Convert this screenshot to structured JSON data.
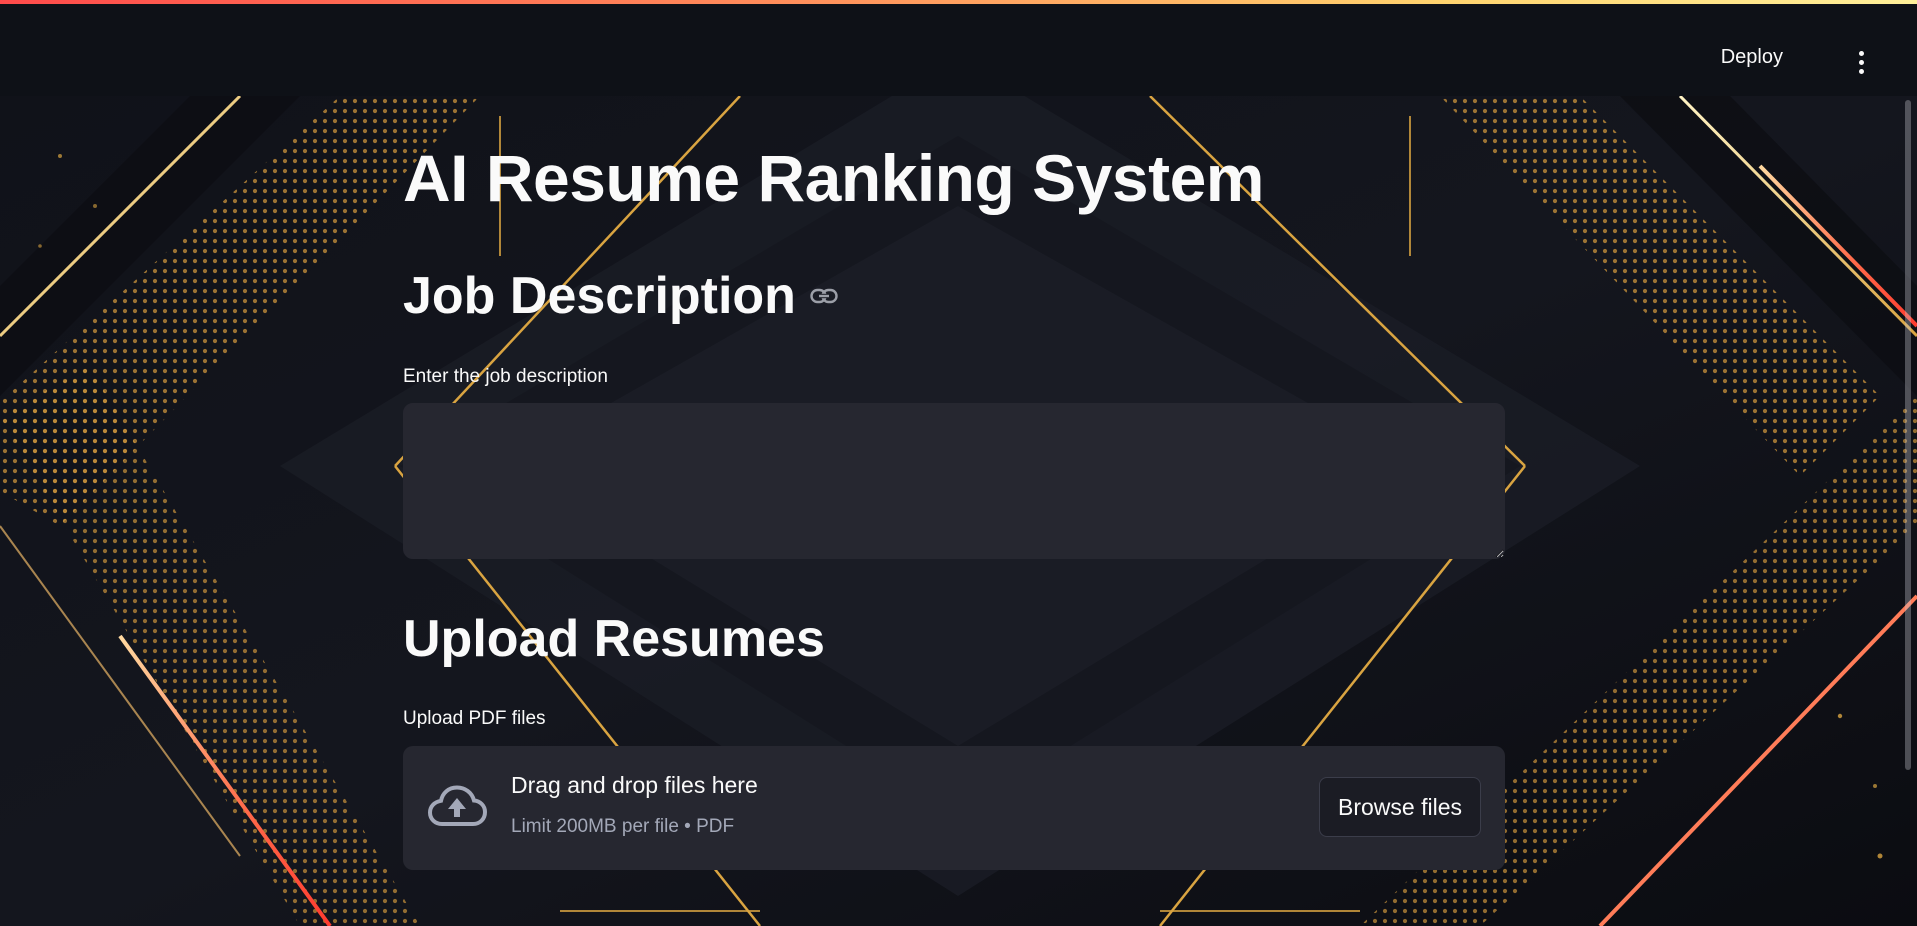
{
  "header": {
    "deploy_label": "Deploy",
    "menu_icon": "vertical-ellipsis-icon"
  },
  "main": {
    "title": "AI Resume Ranking System",
    "job_section": {
      "heading": "Job Description",
      "anchor_icon": "link-icon",
      "textarea_label": "Enter the job description",
      "textarea_value": ""
    },
    "upload_section": {
      "heading": "Upload Resumes",
      "uploader_label": "Upload PDF files",
      "dropzone_icon": "cloud-upload-icon",
      "dropzone_title": "Drag and drop files here",
      "dropzone_limit": "Limit 200MB per file • PDF",
      "browse_label": "Browse files"
    }
  },
  "colors": {
    "header_bg": "#0e1117",
    "input_bg": "#262730",
    "text": "#fafafa",
    "muted_text": "#a3a8b8",
    "gold_accent": "#d9a441",
    "red_accent": "#ff4b4b"
  }
}
